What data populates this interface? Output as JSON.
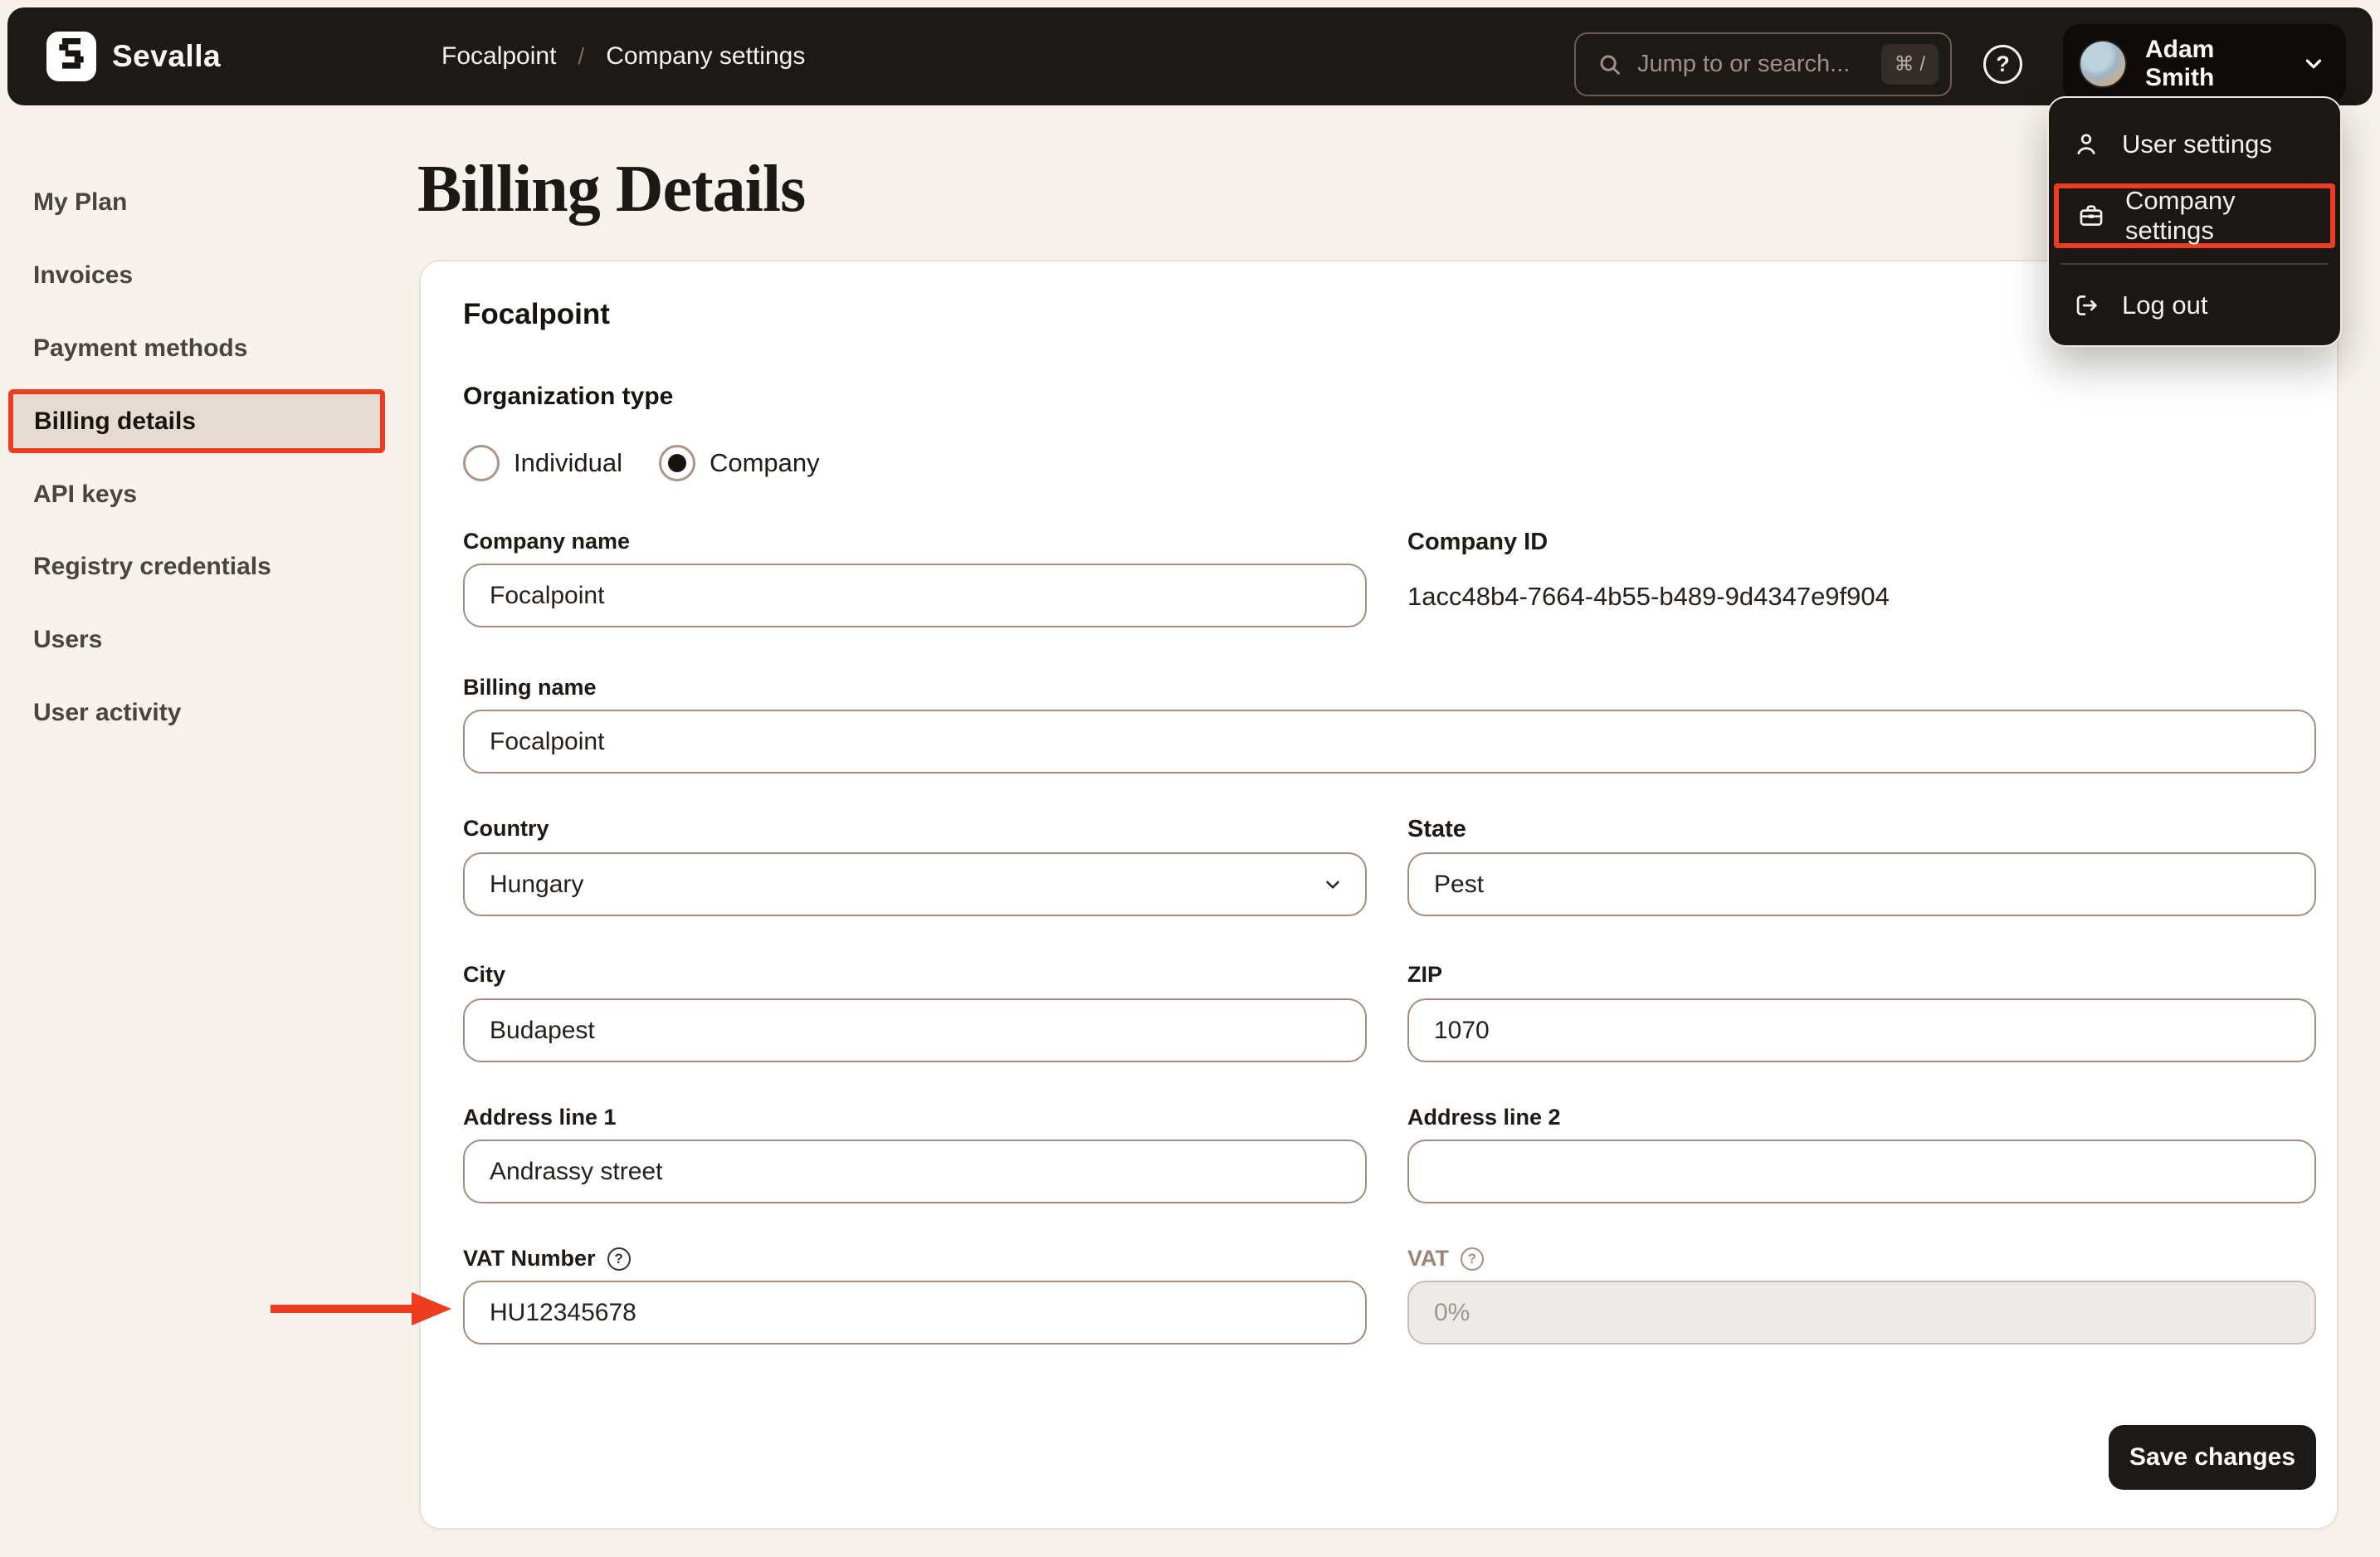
{
  "topbar": {
    "brand": "Sevalla",
    "breadcrumb": {
      "project": "Focalpoint",
      "separator": "/",
      "section": "Company settings"
    },
    "search": {
      "placeholder": "Jump to or search...",
      "shortcut": "⌘ /"
    },
    "help_label": "?",
    "user": {
      "name": "Adam Smith"
    }
  },
  "user_menu": {
    "items": [
      {
        "label": "User settings",
        "icon": "user-icon",
        "highlighted": false
      },
      {
        "label": "Company settings",
        "icon": "briefcase-icon",
        "highlighted": true
      },
      {
        "label": "Log out",
        "icon": "logout-icon",
        "highlighted": false
      }
    ]
  },
  "sidebar": {
    "items": [
      {
        "label": "My Plan",
        "active": false
      },
      {
        "label": "Invoices",
        "active": false
      },
      {
        "label": "Payment methods",
        "active": false
      },
      {
        "label": "Billing details",
        "active": true
      },
      {
        "label": "API keys",
        "active": false
      },
      {
        "label": "Registry credentials",
        "active": false
      },
      {
        "label": "Users",
        "active": false
      },
      {
        "label": "User activity",
        "active": false
      }
    ]
  },
  "page": {
    "title": "Billing Details"
  },
  "form": {
    "company_title": "Focalpoint",
    "organization_type": {
      "label": "Organization type",
      "options": [
        {
          "label": "Individual",
          "selected": false
        },
        {
          "label": "Company",
          "selected": true
        }
      ]
    },
    "company_name": {
      "label": "Company name",
      "value": "Focalpoint"
    },
    "company_id": {
      "label": "Company ID",
      "value": "1acc48b4-7664-4b55-b489-9d4347e9f904"
    },
    "billing_name": {
      "label": "Billing name",
      "value": "Focalpoint"
    },
    "country": {
      "label": "Country",
      "value": "Hungary"
    },
    "state": {
      "label": "State",
      "value": "Pest"
    },
    "city": {
      "label": "City",
      "value": "Budapest"
    },
    "zip": {
      "label": "ZIP",
      "value": "1070"
    },
    "address1": {
      "label": "Address line 1",
      "value": "Andrassy street"
    },
    "address2": {
      "label": "Address line 2",
      "value": ""
    },
    "vat_number": {
      "label": "VAT Number",
      "value": "HU12345678"
    },
    "vat": {
      "label": "VAT",
      "value": "0%",
      "disabled": true
    },
    "save_label": "Save changes"
  },
  "colors": {
    "annotation_red": "#ee3c20",
    "topbar_bg": "#1d1917",
    "page_bg": "#f7f2ec",
    "input_border": "#a38e81",
    "sidebar_active_bg": "#e5dbd3"
  }
}
